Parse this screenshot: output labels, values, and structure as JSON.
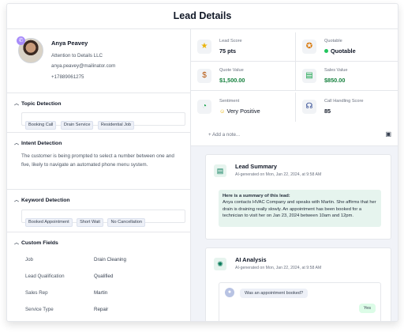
{
  "header": {
    "title": "Lead Details"
  },
  "contact": {
    "name": "Anya Peavey",
    "company": "Attention to Details LLC",
    "email": "anya.peavey@mailinator.com",
    "phone": "+17889061275"
  },
  "topic_detection": {
    "title": "Topic Detection",
    "tags": [
      "Booking Call",
      "Drain Service",
      "Residential Job"
    ]
  },
  "intent_detection": {
    "title": "Intent Detection",
    "text": "The customer is being prompted to select a number between one and five, likely to navigate an automated phone menu system."
  },
  "keyword_detection": {
    "title": "Keyword Detection",
    "tags": [
      "Booked Appointment",
      "Short Wait",
      "No Cancellation"
    ]
  },
  "custom_fields": {
    "title": "Custom Fields",
    "rows": [
      {
        "label": "Job",
        "value": "Drain Cleaning"
      },
      {
        "label": "Lead Qualification",
        "value": "Qualified"
      },
      {
        "label": "Sales Rep",
        "value": "Martin"
      },
      {
        "label": "Service Type",
        "value": "Repair"
      }
    ]
  },
  "stats": [
    {
      "label": "Lead Score",
      "value": "75 pts",
      "icon": "star-icon"
    },
    {
      "label": "Quotable",
      "value": "Quotable",
      "icon": "award-icon"
    },
    {
      "label": "Quote Value",
      "value": "$1,500.00",
      "icon": "money-bag-icon"
    },
    {
      "label": "Sales Value",
      "value": "$850.00",
      "icon": "cash-icon"
    },
    {
      "label": "Sentiment",
      "value": "Very Positive",
      "icon": "sentiment-gauge-icon"
    },
    {
      "label": "Call Handling Score",
      "value": "85",
      "icon": "headset-icon"
    }
  ],
  "notes": {
    "add_label": "+ Add a note..."
  },
  "lead_summary": {
    "title": "Lead Summary",
    "subtitle": "AI-generated on Mon, Jan 22, 2024, at 9:58 AM",
    "heading": "Here is a summary of this lead:",
    "body": "Anya contacts HVAC Company and speaks with Martin. She affirms that her drain is draining really slowly. An appointment has been booked for a technician to visit her on Jan 23, 2024 between 10am and 12pm."
  },
  "ai_analysis": {
    "title": "AI Analysis",
    "subtitle": "AI-generated on Mon, Jan 22, 2024, at 9:58 AM",
    "question": "Was an appointment booked?",
    "answer": "Yes"
  },
  "colors": {
    "accent_green": "#15803d",
    "summary_bg": "#e6f4ee",
    "panel_bg": "#f1f3f8"
  }
}
